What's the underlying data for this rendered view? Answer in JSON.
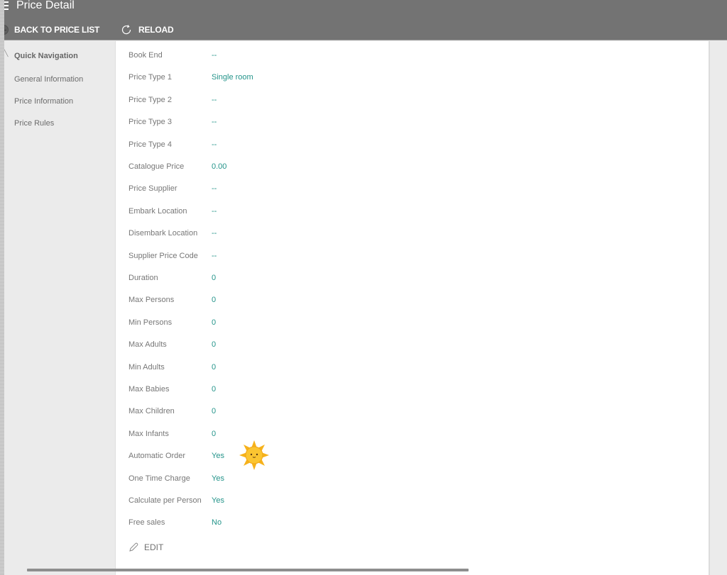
{
  "header": {
    "title": "Price Detail",
    "toolbar": {
      "back_label": "BACK TO PRICE LIST",
      "reload_label": "RELOAD"
    }
  },
  "sidebar": {
    "heading": "Quick Navigation",
    "items": [
      {
        "label": "General Information"
      },
      {
        "label": "Price Information"
      },
      {
        "label": "Price Rules"
      }
    ]
  },
  "fields": [
    {
      "label": "Book End",
      "value": "--"
    },
    {
      "label": "Price Type 1",
      "value": "Single room"
    },
    {
      "label": "Price Type 2",
      "value": "--"
    },
    {
      "label": "Price Type 3",
      "value": "--"
    },
    {
      "label": "Price Type 4",
      "value": "--"
    },
    {
      "label": "Catalogue Price",
      "value": "0.00"
    },
    {
      "label": "Price Supplier",
      "value": "--"
    },
    {
      "label": "Embark Location",
      "value": "--"
    },
    {
      "label": "Disembark Location",
      "value": "--"
    },
    {
      "label": "Supplier Price Code",
      "value": "--"
    },
    {
      "label": "Duration",
      "value": "0"
    },
    {
      "label": "Max Persons",
      "value": "0"
    },
    {
      "label": "Min Persons",
      "value": "0"
    },
    {
      "label": "Max Adults",
      "value": "0"
    },
    {
      "label": "Min Adults",
      "value": "0"
    },
    {
      "label": "Max Babies",
      "value": "0"
    },
    {
      "label": "Max Children",
      "value": "0"
    },
    {
      "label": "Max Infants",
      "value": "0"
    },
    {
      "label": "Automatic Order",
      "value": "Yes"
    },
    {
      "label": "One Time Charge",
      "value": "Yes"
    },
    {
      "label": "Calculate per Person",
      "value": "Yes"
    },
    {
      "label": "Free sales",
      "value": "No"
    }
  ],
  "actions": {
    "edit_label": "EDIT"
  },
  "colors": {
    "header_bg": "#737373",
    "value_accent": "#24948a",
    "label_text": "#777777"
  }
}
